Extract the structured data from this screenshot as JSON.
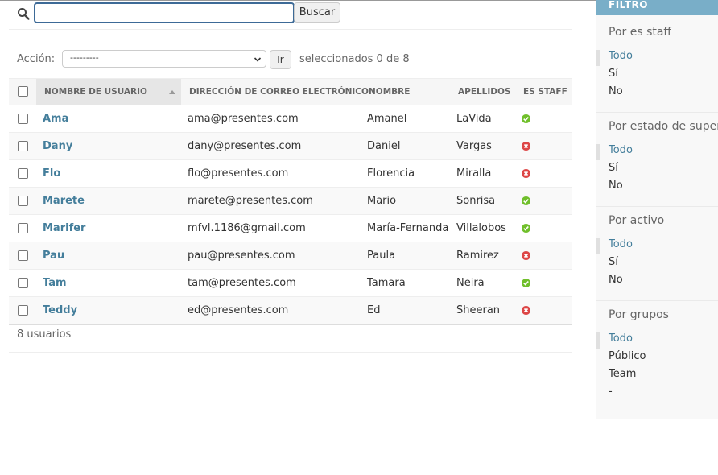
{
  "search": {
    "value": "",
    "button_label": "Buscar"
  },
  "actions": {
    "label": "Acción:",
    "selected_option": "---------",
    "go_label": "Ir",
    "counter": "seleccionados 0 de 8"
  },
  "table": {
    "columns": [
      "Nombre de usuario",
      "Dirección de correo electrónico",
      "Nombre",
      "Apellidos",
      "Es staff"
    ],
    "rows": [
      {
        "username": "Ama",
        "email": "ama@presentes.com",
        "first_name": "Amanel",
        "last_name": "LaVida",
        "is_staff": true
      },
      {
        "username": "Dany",
        "email": "dany@presentes.com",
        "first_name": "Daniel",
        "last_name": "Vargas",
        "is_staff": false
      },
      {
        "username": "Flo",
        "email": "flo@presentes.com",
        "first_name": "Florencia",
        "last_name": "Miralla",
        "is_staff": false
      },
      {
        "username": "Marete",
        "email": "marete@presentes.com",
        "first_name": "Mario",
        "last_name": "Sonrisa",
        "is_staff": true
      },
      {
        "username": "Marifer",
        "email": "mfvl.1186@gmail.com",
        "first_name": "María-Fernanda",
        "last_name": "Villalobos",
        "is_staff": true
      },
      {
        "username": "Pau",
        "email": "pau@presentes.com",
        "first_name": "Paula",
        "last_name": "Ramirez",
        "is_staff": false
      },
      {
        "username": "Tam",
        "email": "tam@presentes.com",
        "first_name": "Tamara",
        "last_name": "Neira",
        "is_staff": true
      },
      {
        "username": "Teddy",
        "email": "ed@presentes.com",
        "first_name": "Ed",
        "last_name": "Sheeran",
        "is_staff": false
      }
    ],
    "count_text": "8 usuarios"
  },
  "filter": {
    "title": "FILTRO",
    "groups": [
      {
        "title": "Por es staff",
        "options": [
          "Todo",
          "Sí",
          "No"
        ]
      },
      {
        "title": "Por estado de superusuario",
        "options": [
          "Todo",
          "Sí",
          "No"
        ]
      },
      {
        "title": "Por activo",
        "options": [
          "Todo",
          "Sí",
          "No"
        ]
      },
      {
        "title": "Por grupos",
        "options": [
          "Todo",
          "Público",
          "Team",
          "-"
        ]
      }
    ]
  },
  "colors": {
    "link": "#447e9b",
    "filter_header": "#79aec8",
    "yes_icon": "#70bf2b",
    "no_icon": "#dd4646",
    "focus_border": "#3d6a97"
  }
}
